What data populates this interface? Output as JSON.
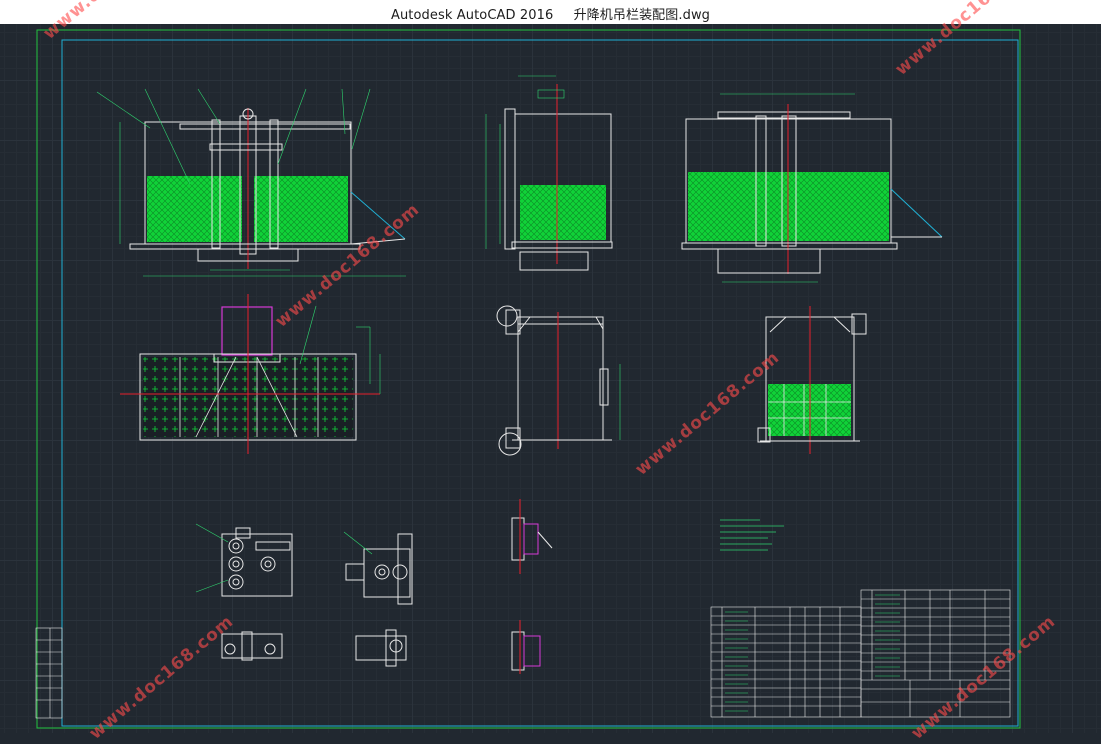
{
  "window": {
    "app_title": "Autodesk AutoCAD 2016",
    "file_name": "升降机吊栏装配图.dwg"
  },
  "watermark": {
    "text": "www.doc168.com"
  },
  "colors": {
    "background": "#212830",
    "frame": "#22c33f",
    "inner_frame": "#20b0d4",
    "mesh": "#10d238",
    "geometry": "#e8e8e8",
    "dimension": "#2fd56f",
    "centerline": "#e6202d",
    "highlight": "#d73ad7",
    "watermark": "#ff4b4b"
  },
  "icons": [
    "grid-icon"
  ]
}
